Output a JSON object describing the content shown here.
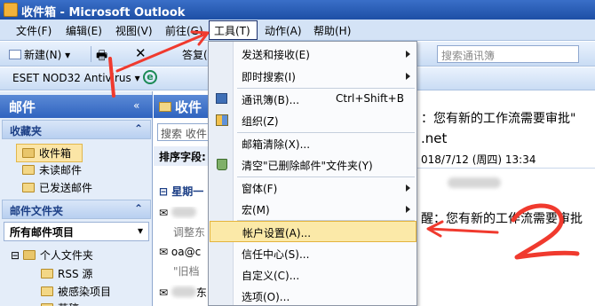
{
  "window": {
    "title": "收件箱 - Microsoft Outlook"
  },
  "menubar": {
    "items": [
      "文件(F)",
      "编辑(E)",
      "视图(V)",
      "前往(G)",
      "工具(T)",
      "动作(A)",
      "帮助(H)"
    ]
  },
  "toolbar": {
    "new_label": "新建(N)",
    "partial_label": "答复(",
    "search_placeholder": "搜索通讯簿",
    "eset_label": "ESET NOD32 Antivirus"
  },
  "nav": {
    "header": "邮件",
    "favorites_header": "收藏夹",
    "favorites": [
      "收件箱",
      "未读邮件",
      "已发送邮件"
    ],
    "mail_folders_header": "邮件文件夹",
    "all_items": "所有邮件项目",
    "tree": [
      "个人文件夹",
      "RSS 源",
      "被感染项目",
      "草稿"
    ]
  },
  "middle": {
    "header": "收件",
    "search": "搜索 收件",
    "sort_label": "排序字段:",
    "group_label": "星期一",
    "rows": [
      "调整东",
      "oa@c",
      "\"旧档",
      "东"
    ]
  },
  "reading": {
    "subject": "：您有新的工作流需要审批\"",
    "from_domain": ".net",
    "date": "018/7/12 (周四) 13:34",
    "body": "醒：您有新的工作流需要审批"
  },
  "tools_menu": {
    "items": [
      {
        "label": "发送和接收(E)",
        "submenu": true
      },
      {
        "label": "即时搜索(I)",
        "submenu": true
      },
      {
        "label": "通讯簿(B)...",
        "shortcut": "Ctrl+Shift+B",
        "icon": "address-book-icon"
      },
      {
        "label": "组织(Z)",
        "icon": "organize-icon"
      },
      {
        "label": "邮箱清除(X)..."
      },
      {
        "label": "清空\"已删除邮件\"文件夹(Y)",
        "icon": "recycle-bin-icon"
      },
      {
        "label": "窗体(F)",
        "submenu": true
      },
      {
        "label": "宏(M)",
        "submenu": true
      },
      {
        "label": "帐户设置(A)...",
        "highlighted": true
      },
      {
        "label": "信任中心(S)..."
      },
      {
        "label": "自定义(C)..."
      },
      {
        "label": "选项(O)..."
      }
    ]
  },
  "annotations": {
    "step1": "1",
    "step2": "2",
    "arrow_color": "#f03a2e"
  },
  "colors": {
    "accent": "#2f63bf",
    "highlight": "#fbe9a8"
  }
}
